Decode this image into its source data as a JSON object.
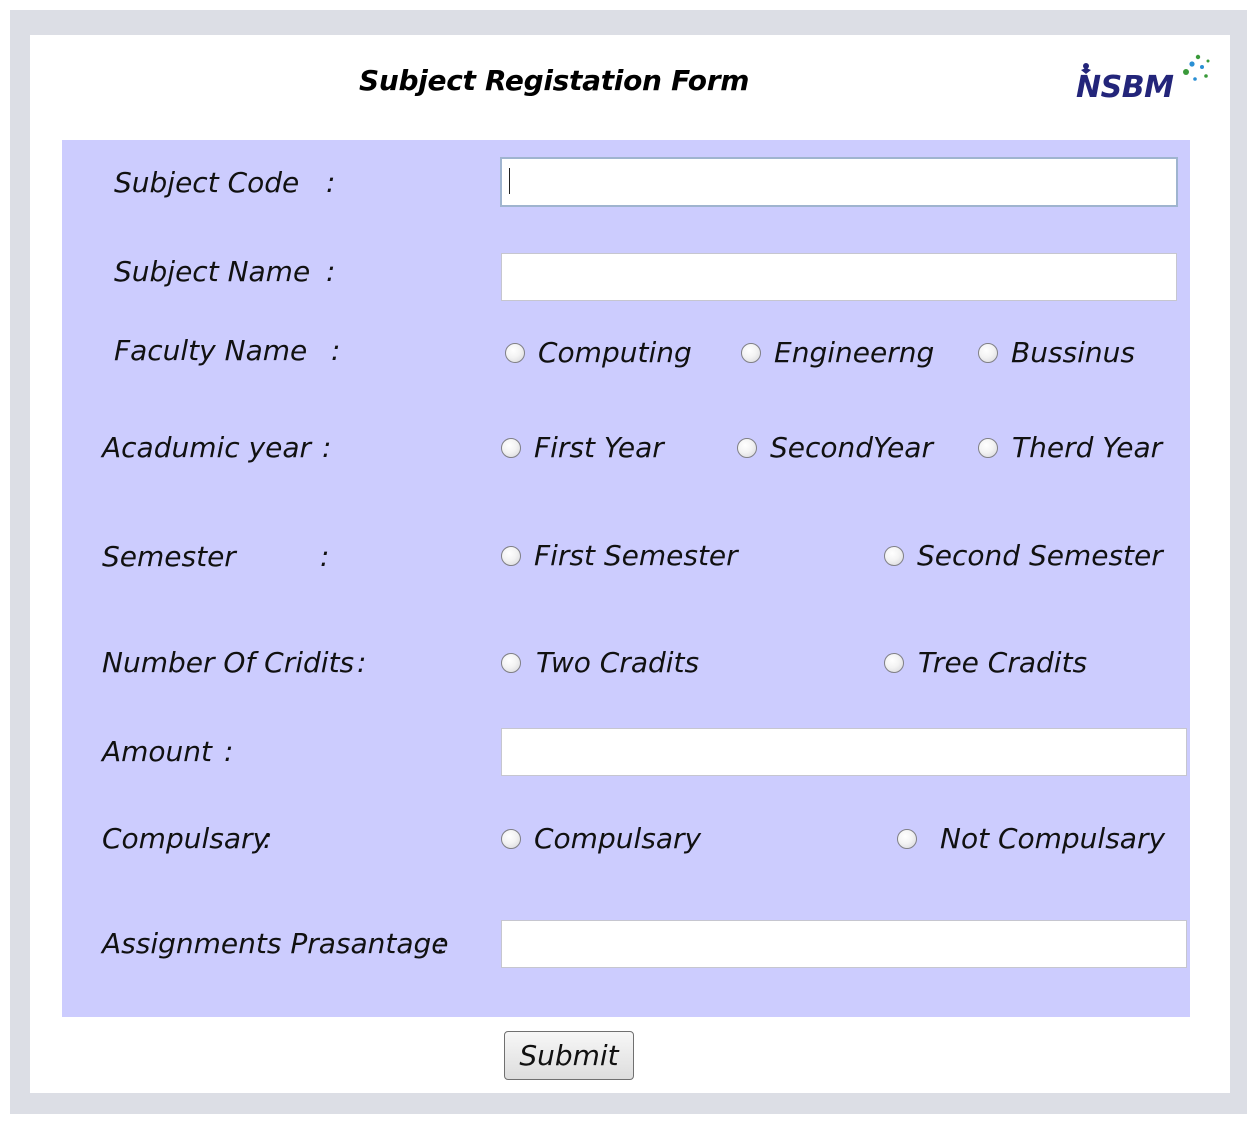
{
  "form": {
    "title": "Subject Registation Form",
    "logo_text": "NSBM",
    "submit_label": "Submit"
  },
  "fields": {
    "subject_code": {
      "label": "Subject Code",
      "colon": ":",
      "value": ""
    },
    "subject_name": {
      "label": "Subject Name",
      "colon": ":",
      "value": ""
    },
    "faculty_name": {
      "label": "Faculty Name",
      "colon": ":",
      "options": [
        "Computing",
        "Engineerng",
        "Bussinus"
      ]
    },
    "academic_year": {
      "label": "Acadumic year",
      "colon": ":",
      "options": [
        "First Year",
        "SecondYear",
        "Therd Year"
      ]
    },
    "semester": {
      "label": "Semester",
      "colon": ":",
      "options": [
        "First Semester",
        "Second Semester"
      ]
    },
    "credits": {
      "label": "Number Of Cridits",
      "colon": ":",
      "options": [
        "Two Cradits",
        "Tree Cradits"
      ]
    },
    "amount": {
      "label": "Amount",
      "colon": ":",
      "value": ""
    },
    "compulsary": {
      "label": "Compulsary",
      "colon": ":",
      "options": [
        "Compulsary",
        "Not Compulsary"
      ]
    },
    "assignments": {
      "label": "Assignments Prasantage",
      "colon": ":",
      "value": ""
    }
  }
}
